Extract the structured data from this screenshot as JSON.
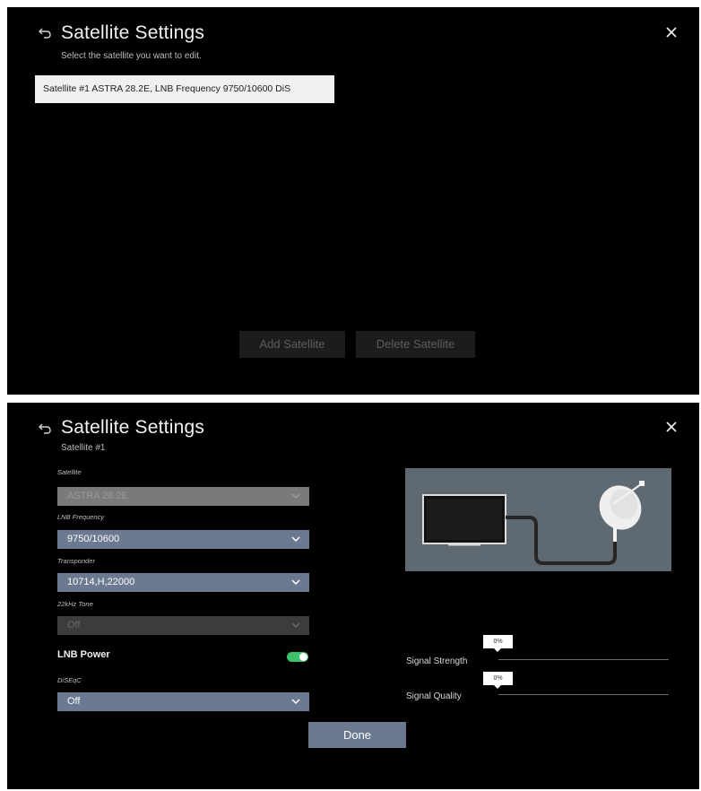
{
  "list_screen": {
    "title": "Satellite Settings",
    "subtitle": "Select the satellite you want to edit.",
    "satellites": [
      "Satellite #1 ASTRA 28.2E, LNB Frequency 9750/10600 DiS"
    ],
    "add_button": "Add Satellite",
    "delete_button": "Delete Satellite"
  },
  "edit_screen": {
    "title": "Satellite Settings",
    "subtitle": "Satellite #1",
    "fields": {
      "satellite": {
        "label": "Satellite",
        "value": "ASTRA 28.2E",
        "state": "disabled"
      },
      "lnb_frequency": {
        "label": "LNB Frequency",
        "value": "9750/10600"
      },
      "transponder": {
        "label": "Transponder",
        "value": "10714,H,22000"
      },
      "tone": {
        "label": "22kHz Tone",
        "value": "Off",
        "state": "disabled"
      },
      "lnb_power": {
        "label": "LNB Power",
        "on": true
      },
      "diseqc": {
        "label": "DiSEqC",
        "value": "Off"
      }
    },
    "signal_strength": {
      "label": "Signal Strength",
      "value": "0%"
    },
    "signal_quality": {
      "label": "Signal Quality",
      "value": "0%"
    },
    "done_button": "Done"
  },
  "colors": {
    "accent": "#6b7a90",
    "toggle_on": "#3fc06a",
    "illustration_bg": "#5f6971"
  },
  "icons": [
    "back-arrow-icon",
    "close-icon",
    "chevron-down-icon",
    "tv-icon",
    "satellite-dish-icon"
  ]
}
